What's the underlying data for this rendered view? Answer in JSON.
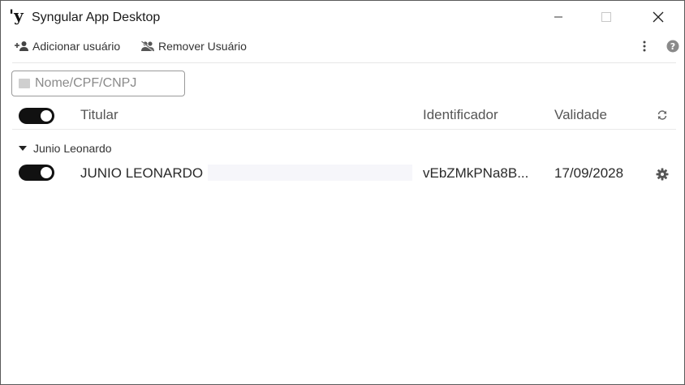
{
  "window": {
    "logo": "'y",
    "title": "Syngular App Desktop"
  },
  "toolbar": {
    "add_label": "Adicionar usuário",
    "remove_label": "Remover Usuário"
  },
  "search": {
    "placeholder": "Nome/CPF/CNPJ",
    "value": ""
  },
  "table": {
    "columns": {
      "titular": "Titular",
      "identificador": "Identificador",
      "validade": "Validade"
    },
    "all_enabled": true,
    "groups": [
      {
        "name": "Junio Leonardo",
        "expanded": true,
        "rows": [
          {
            "enabled": true,
            "titular": "JUNIO LEONARDO",
            "identificador": "vEbZMkPNa8B...",
            "validade": "17/09/2028"
          }
        ]
      }
    ]
  },
  "icons": {
    "add_user": "add-user-icon",
    "remove_user": "remove-user-icon",
    "more": "more-vertical-icon",
    "help": "help-icon",
    "refresh": "refresh-icon",
    "settings": "gear-icon"
  }
}
